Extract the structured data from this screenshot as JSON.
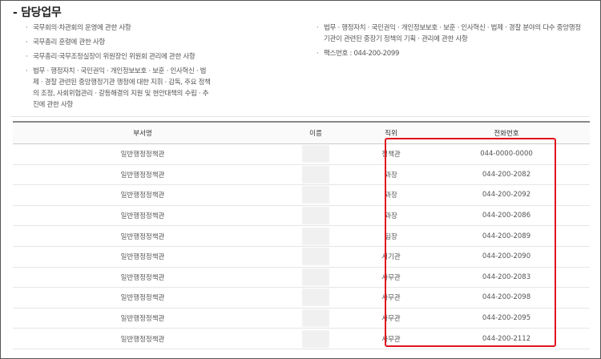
{
  "section_title": "- 담당업무",
  "duties_left": [
    "국무회의·차관회의 운영에 관한 사항",
    "국무총리 훈령에 관한 사항",
    "국무총리·국무조정실장이 위원장인 위원회 관리에 관한 사항",
    "법무 · 행정자치 · 국민권익 · 개인정보보호 · 보훈 · 인사혁신 · 법제 · 경찰 관련된 중앙행정기관 행정에 대한 지휘 · 감독, 주요 정책의 조정, 사회위험관리 · 갈등해결의 지원 및 현안대책의 수립 · 추진에 관한 사항"
  ],
  "duties_right": [
    "법무 · 행정자치 · 국민권익 · 개인정보보호 · 보훈 · 인사혁신 · 법제 · 경찰 분야의 다수 중앙행정기관이 관련된 중장기 정책의 기획 · 관리에 관한 사항",
    "팩스번호 : 044-200-2099"
  ],
  "table": {
    "headers": [
      "부서명",
      "이름",
      "직위",
      "전화번호"
    ],
    "rows": [
      {
        "dept": "일반행정정책관",
        "position": "정책관",
        "phone": "044-0000-0000"
      },
      {
        "dept": "일반행정정책관",
        "position": "과장",
        "phone": "044-200-2082"
      },
      {
        "dept": "일반행정정책관",
        "position": "과장",
        "phone": "044-200-2092"
      },
      {
        "dept": "일반행정정책관",
        "position": "과장",
        "phone": "044-200-2086"
      },
      {
        "dept": "일반행정정책관",
        "position": "팀장",
        "phone": "044-200-2089"
      },
      {
        "dept": "일반행정정책관",
        "position": "서기관",
        "phone": "044-200-2090"
      },
      {
        "dept": "일반행정정책관",
        "position": "사무관",
        "phone": "044-200-2083"
      },
      {
        "dept": "일반행정정책관",
        "position": "사무관",
        "phone": "044-200-2098"
      },
      {
        "dept": "일반행정정책관",
        "position": "사무관",
        "phone": "044-200-2095"
      },
      {
        "dept": "일반행정정책관",
        "position": "사무관",
        "phone": "044-200-2112"
      }
    ]
  },
  "bullet": "·",
  "highlight_color": "#e2141e"
}
